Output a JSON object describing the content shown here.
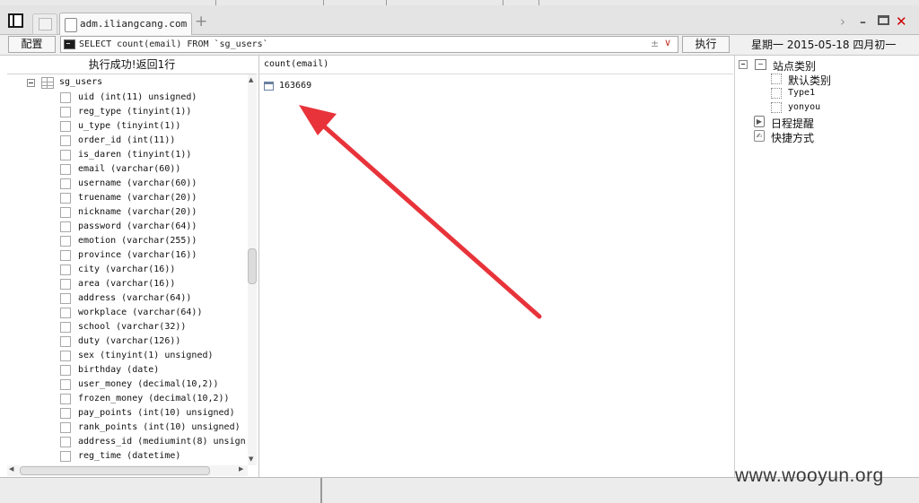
{
  "tab": {
    "title": "adm.iliangcang.com",
    "new_tab": "+"
  },
  "window": {
    "chevron": "›",
    "minimize": "–",
    "close": "✕"
  },
  "toolbar": {
    "config_label": "配置",
    "sql_query": "SELECT count(email) FROM `sg_users`",
    "sql_pm": "±",
    "exec_label": "执行",
    "calendar": "星期一  2015-05-18  四月初一"
  },
  "left_panel": {
    "status": "执行成功!返回1行",
    "table_name": "sg_users",
    "columns": [
      "uid (int(11) unsigned)",
      "reg_type (tinyint(1))",
      "u_type (tinyint(1))",
      "order_id (int(11))",
      "is_daren (tinyint(1))",
      "email (varchar(60))",
      "username (varchar(60))",
      "truename (varchar(20))",
      "nickname (varchar(20))",
      "password (varchar(64))",
      "emotion (varchar(255))",
      "province (varchar(16))",
      "city (varchar(16))",
      "area (varchar(16))",
      "address (varchar(64))",
      "workplace (varchar(64))",
      "school (varchar(32))",
      "duty (varchar(126))",
      "sex (tinyint(1) unsigned)",
      "birthday (date)",
      "user_money (decimal(10,2))",
      "frozen_money (decimal(10,2))",
      "pay_points (int(10) unsigned)",
      "rank_points (int(10) unsigned)",
      "address_id (mediumint(8) unsign",
      "reg_time (datetime)"
    ]
  },
  "result": {
    "column_header": "count(email)",
    "rows": [
      "163669"
    ]
  },
  "right_panel": {
    "site_category": "站点类别",
    "default_category": "默认类别",
    "type1": "Type1",
    "yonyou": "yonyou",
    "schedule": "日程提醒",
    "shortcut": "快捷方式"
  },
  "watermark": "www.wooyun.org",
  "colors": {
    "arrow": "#e8333a",
    "close": "#cc0000"
  },
  "icons": [
    "panel-toggle-icon",
    "page-icon",
    "terminal-icon",
    "table-grid-icon",
    "checkbox-icon",
    "result-row-icon",
    "folder-icon",
    "schedule-icon",
    "shortcut-icon"
  ]
}
